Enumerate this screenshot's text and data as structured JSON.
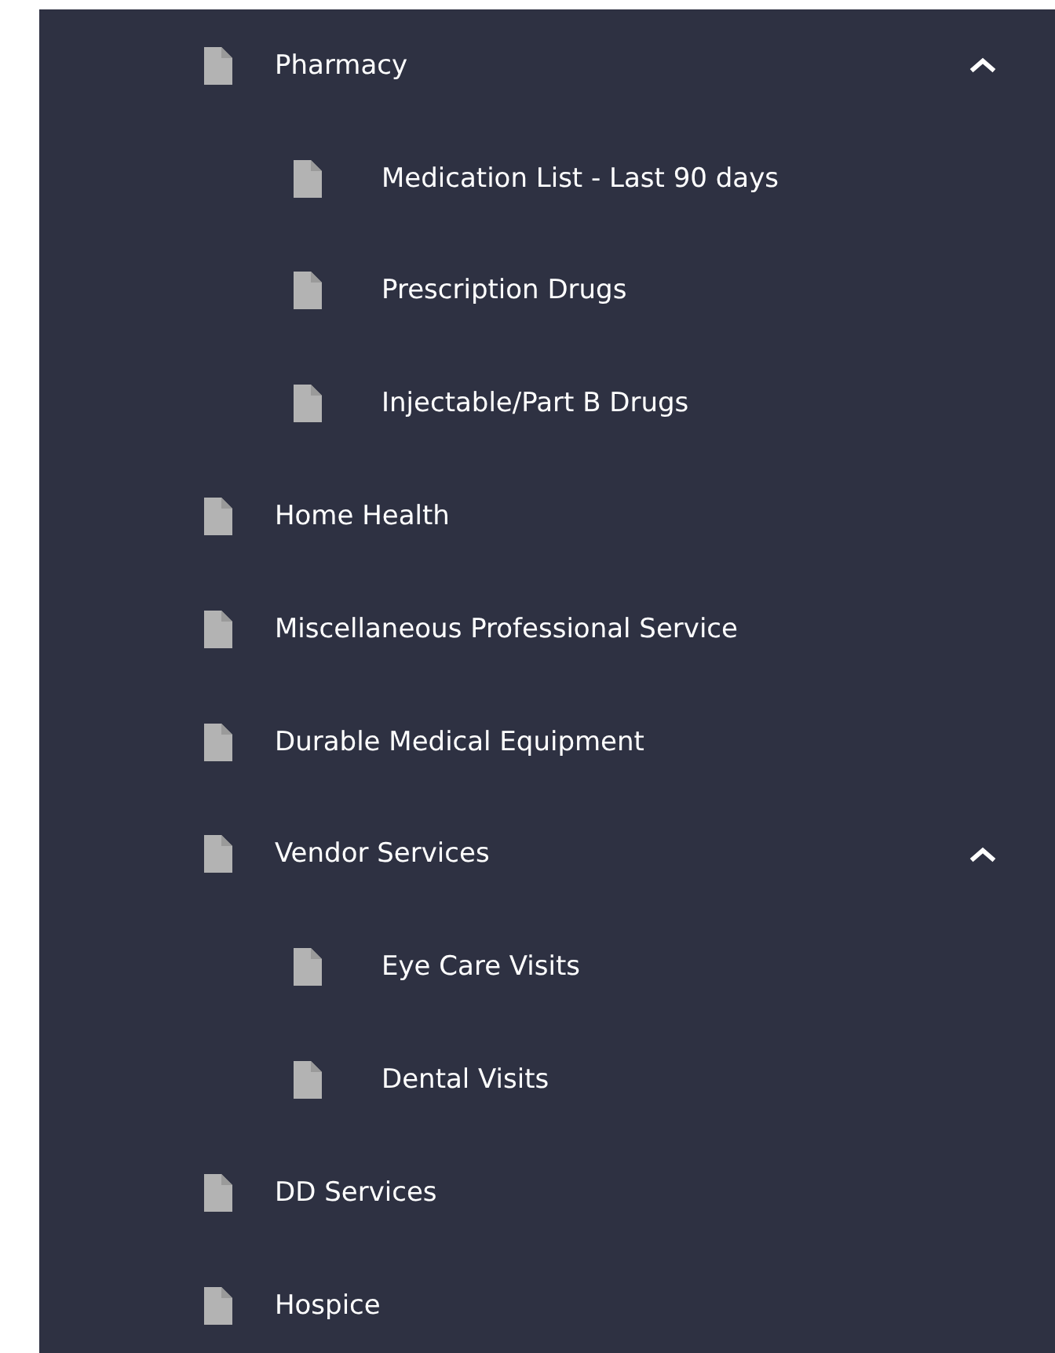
{
  "menu": [
    {
      "label": "Pharmacy",
      "expanded": true,
      "children": [
        {
          "label": "Medication List - Last 90 days"
        },
        {
          "label": "Prescription Drugs"
        },
        {
          "label": "Injectable/Part B Drugs"
        }
      ]
    },
    {
      "label": "Home Health"
    },
    {
      "label": "Miscellaneous Professional Service"
    },
    {
      "label": "Durable Medical Equipment"
    },
    {
      "label": "Vendor Services",
      "expanded": true,
      "children": [
        {
          "label": "Eye Care Visits"
        },
        {
          "label": "Dental Visits"
        }
      ]
    },
    {
      "label": "DD Services"
    },
    {
      "label": "Hospice"
    }
  ]
}
